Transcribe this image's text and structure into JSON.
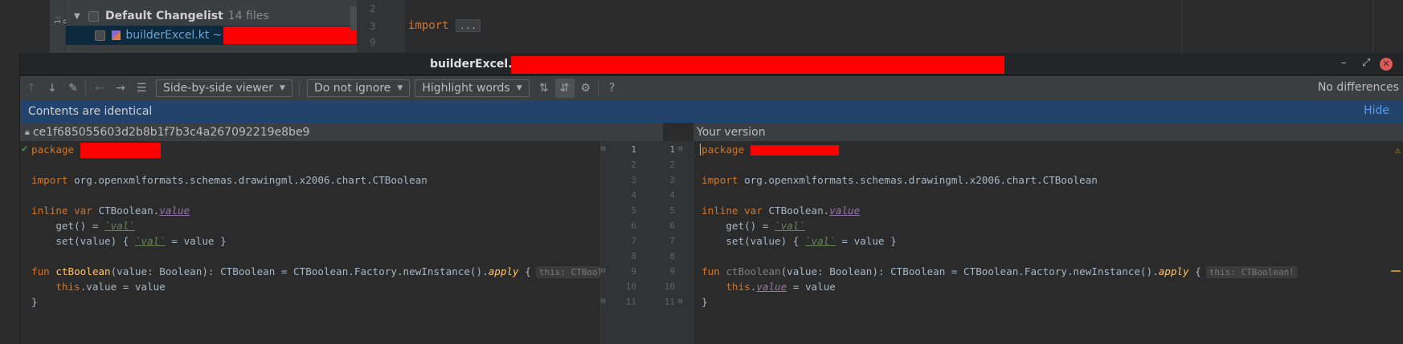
{
  "background_ide": {
    "toolwindow_tab": "1: P",
    "changelist": {
      "name": "Default Changelist",
      "count": "14 files"
    },
    "selected_file": {
      "name": "builderExcel.kt",
      "suffix": "~"
    },
    "editor_lines": [
      "2",
      "3",
      "9"
    ],
    "editor_import": "import",
    "editor_folded": "..."
  },
  "dialog": {
    "title": "builderExcel.kt",
    "window_controls": {
      "minimize": "–",
      "maximize": "⤢",
      "close": "✕"
    }
  },
  "toolbar": {
    "icons": {
      "prev_diff": "↑",
      "next_diff": "↓",
      "edit": "✎",
      "back": "←",
      "forward": "→",
      "list": "☰",
      "collapse": "⇅",
      "sync_scroll": "⇵",
      "settings": "⚙",
      "help": "?"
    },
    "viewer_combo": "Side-by-side viewer",
    "ignore_combo": "Do not ignore",
    "highlight_combo": "Highlight words",
    "status": "No differences"
  },
  "banner": {
    "message": "Contents are identical",
    "hide_label": "Hide"
  },
  "left_header": {
    "revision": "ce1f685055603d2b8b1f7b3c4a267092219e8be9"
  },
  "right_header": {
    "label": "Your version"
  },
  "code": {
    "package_kw": "package",
    "import_kw": "import",
    "import_path": "org.openxmlformats.schemas.drawingml.x2006.chart.CTBoolean",
    "inline_kw": "inline",
    "var_kw": "var",
    "receiver": "CTBoolean.",
    "prop_name": "value",
    "get_text": "get() = ",
    "val_tick": "`val`",
    "set_text_a": "set(value) { ",
    "set_text_b": " = value }",
    "fun_kw": "fun",
    "fun_name": "ctBoolean",
    "fun_sig": "(value: Boolean): CTBoolean = CTBoolean.Factory.newInstance().",
    "apply": "apply",
    "brace": " {",
    "hint": "this: CTBoolean!",
    "this_kw": "this",
    "this_rest_left": ".value = value",
    "this_dot": ".",
    "this_val_right": "value",
    "this_rest_right": " = value",
    "close_brace": "}"
  },
  "line_numbers": [
    "1",
    "2",
    "3",
    "4",
    "5",
    "6",
    "7",
    "8",
    "9",
    "10",
    "11"
  ]
}
